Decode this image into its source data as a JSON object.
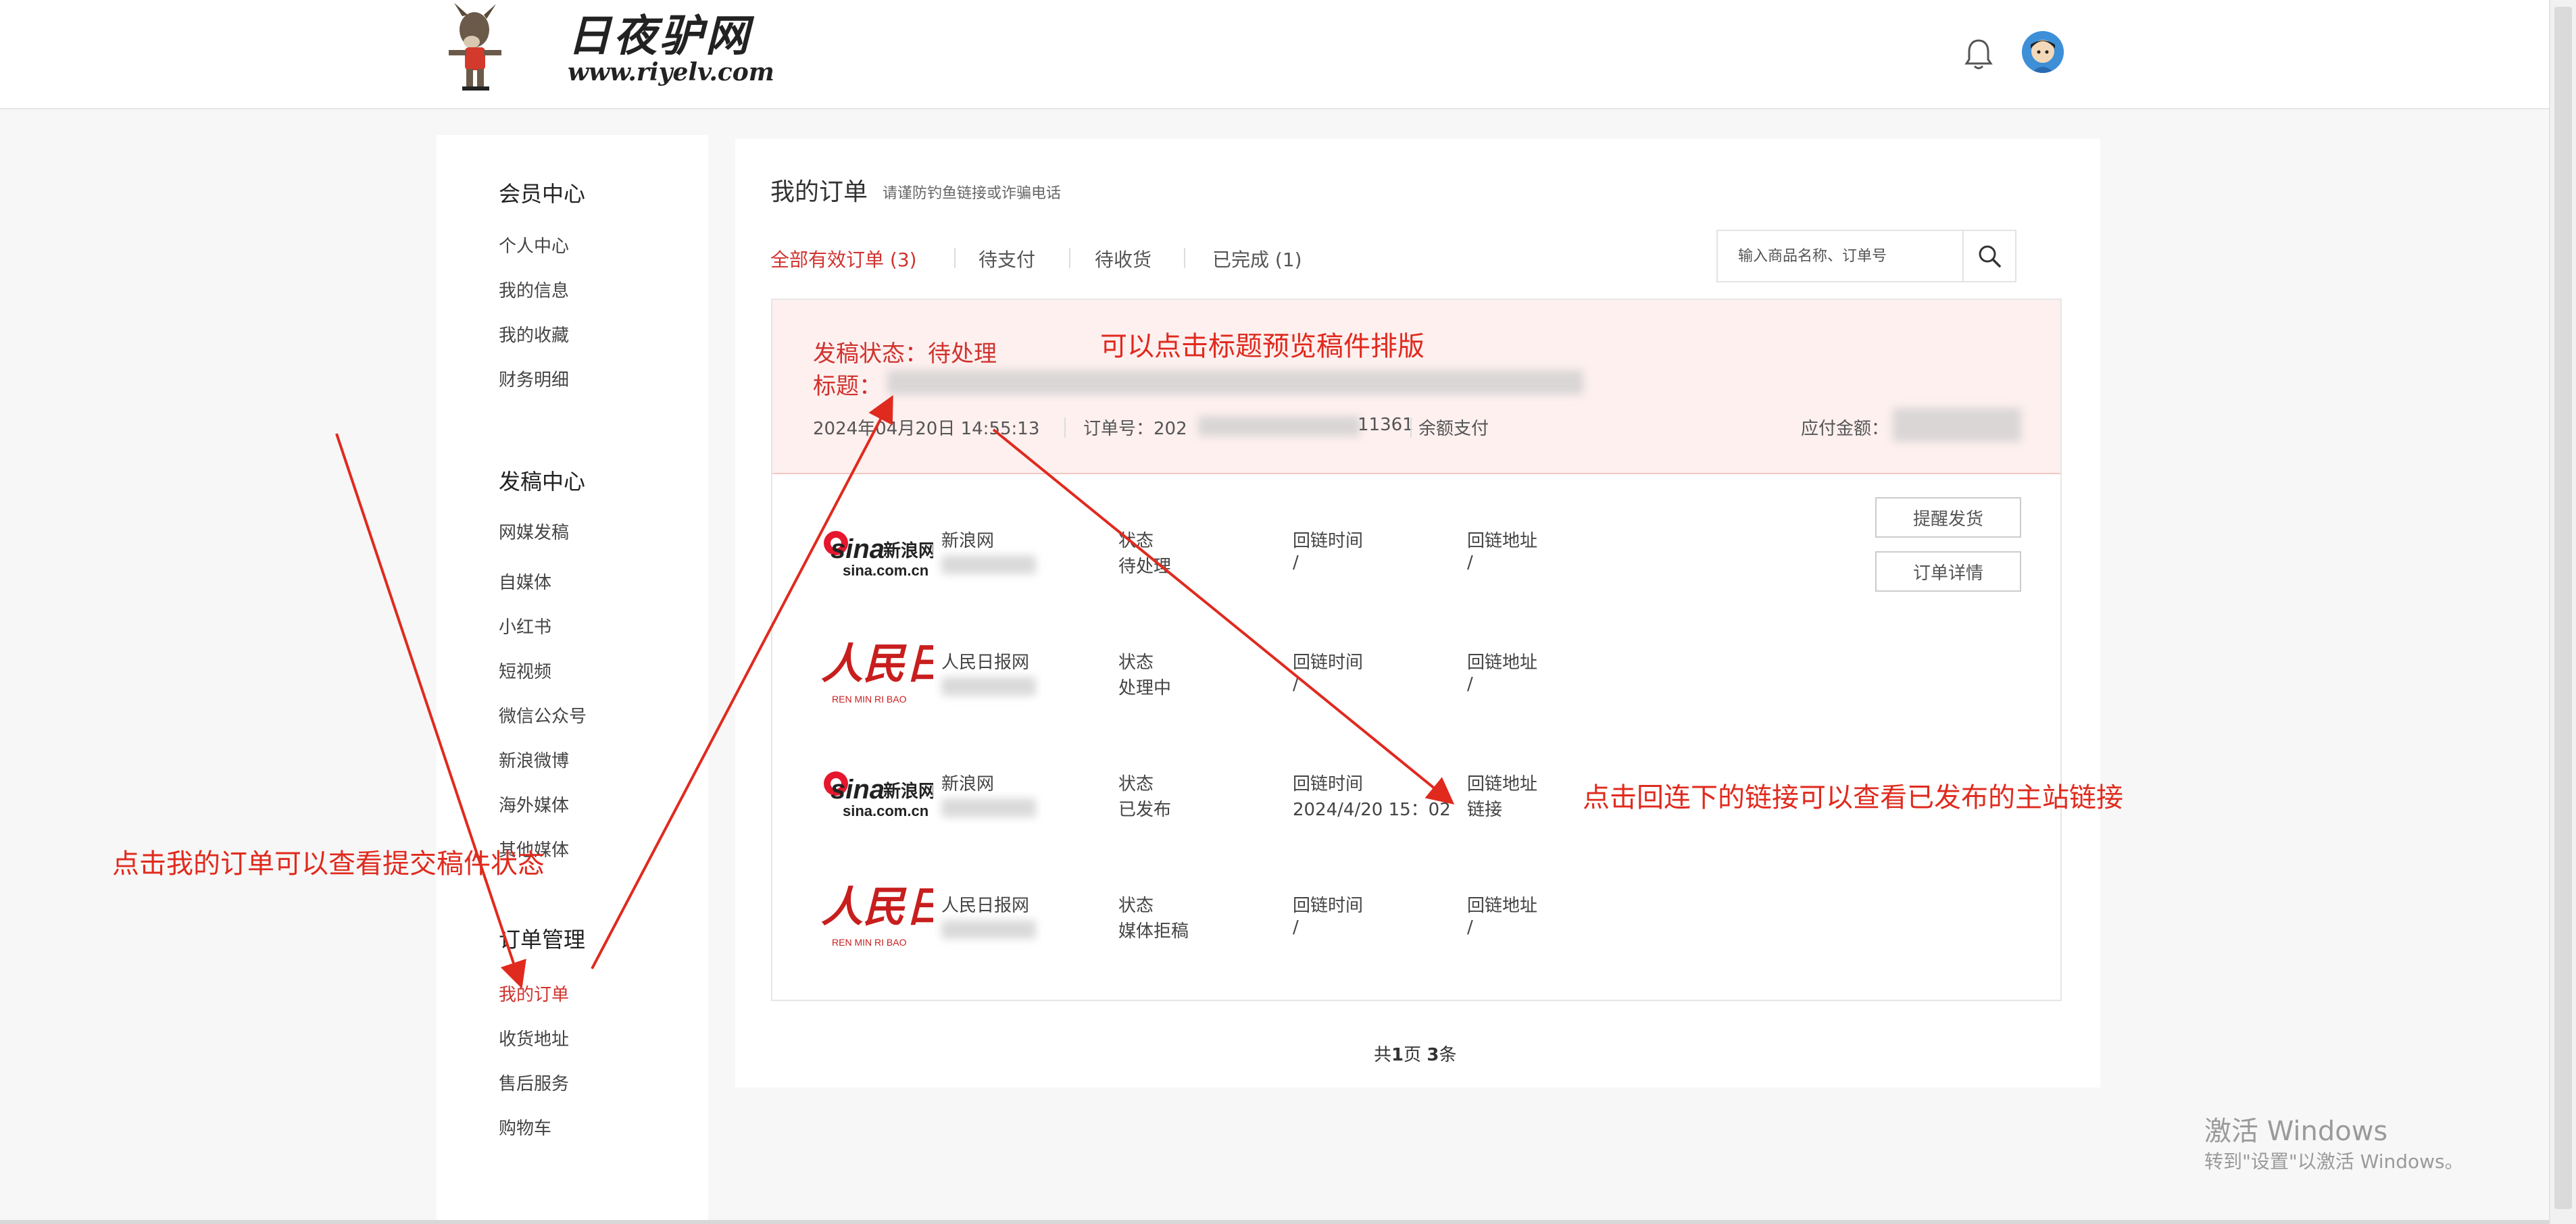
{
  "header": {
    "site_name": "日夜驴网",
    "site_url": "www.riyelv.com",
    "bell_icon": "bell-icon",
    "avatar_icon": "avatar"
  },
  "sidebar": {
    "groups": [
      {
        "title": "会员中心",
        "items": [
          "个人中心",
          "我的信息",
          "我的收藏",
          "财务明细"
        ]
      },
      {
        "title": "发稿中心",
        "items": [
          "网媒发稿",
          "自媒体",
          "小红书",
          "短视频",
          "微信公众号",
          "新浪微博",
          "海外媒体",
          "其他媒体"
        ]
      },
      {
        "title": "订单管理",
        "items": [
          "我的订单",
          "收货地址",
          "售后服务",
          "购物车"
        ]
      }
    ],
    "active_item": "我的订单"
  },
  "main": {
    "title": "我的订单",
    "tip": "请谨防钓鱼链接或诈骗电话",
    "tabs": [
      "全部有效订单 (3)",
      "待支付",
      "待收货",
      "已完成 (1)"
    ],
    "active_tab": "全部有效订单 (3)",
    "search": {
      "placeholder": "输入商品名称、订单号"
    },
    "order": {
      "status": "发稿状态：待处理",
      "title_label": "标题：",
      "date": "2024年04月20日 14:55:13",
      "order_no_label": "订单号：202",
      "order_no_tail": "11361",
      "pay_method": "余额支付",
      "amount_label": "应付金额："
    },
    "rows": [
      {
        "media": "新浪网",
        "logo": "sina-logo",
        "status_label": "状态",
        "status": "待处理",
        "time_label": "回链时间",
        "time": "/",
        "addr_label": "回链地址",
        "addr": "/"
      },
      {
        "media": "人民日报网",
        "logo": "people-daily-logo",
        "status_label": "状态",
        "status": "处理中",
        "time_label": "回链时间",
        "time": "/",
        "addr_label": "回链地址",
        "addr": "/"
      },
      {
        "media": "新浪网",
        "logo": "sina-logo",
        "status_label": "状态",
        "status": "已发布",
        "time_label": "回链时间",
        "time": "2024/4/20 15：02",
        "addr_label": "回链地址",
        "addr": "链接"
      },
      {
        "media": "人民日报网",
        "logo": "people-daily-logo",
        "status_label": "状态",
        "status": "媒体拒稿",
        "time_label": "回链时间",
        "time": "/",
        "addr_label": "回链地址",
        "addr": "/"
      }
    ],
    "buttons": {
      "remind": "提醒发货",
      "detail": "订单详情"
    },
    "pager": {
      "prefix": "共",
      "pages": "1",
      "mid": "页 ",
      "count": "3",
      "suffix": "条"
    }
  },
  "annotations": {
    "preview": "可以点击标题预览稿件排版",
    "my_orders": "点击我的订单可以查看提交稿件状态",
    "backlink": "点击回连下的链接可以查看已发布的主站链接",
    "color": "#e02a1e"
  },
  "windows_watermark": {
    "line1": "激活 Windows",
    "line2": "转到\"设置\"以激活 Windows。"
  },
  "colors": {
    "accent": "#d0332f",
    "order_head_bg": "#fdf0ef"
  }
}
